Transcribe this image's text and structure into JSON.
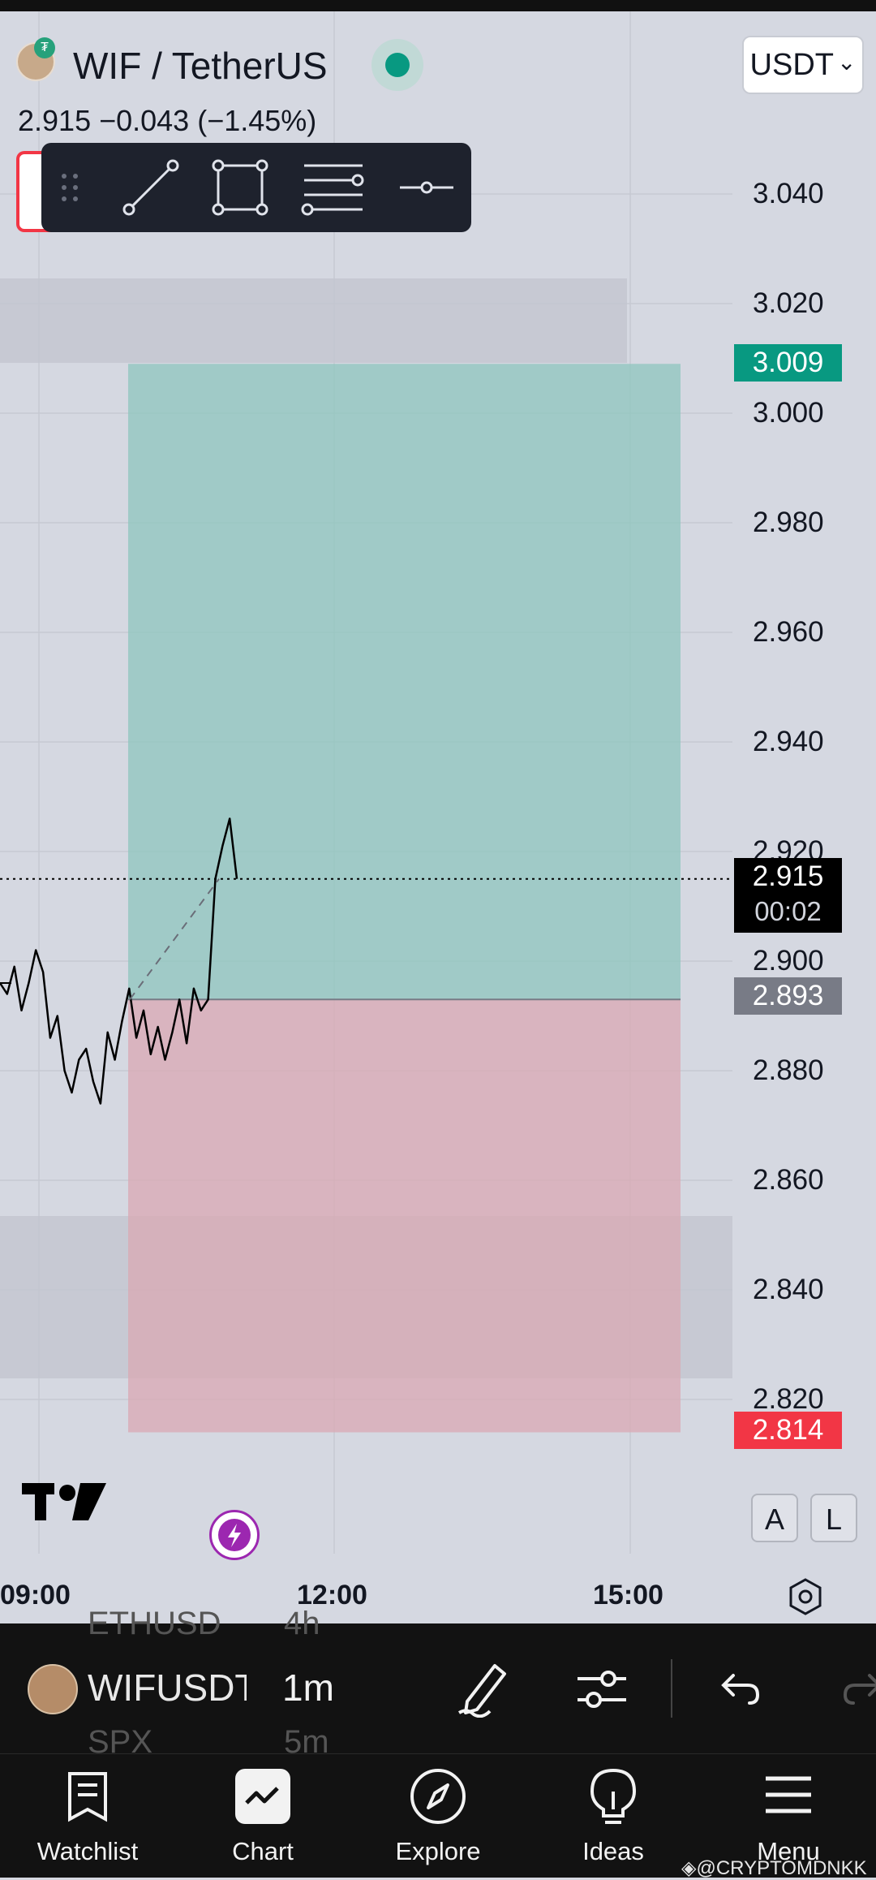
{
  "header": {
    "symbol_title": "WIF / TetherUS",
    "quote": "2.915  −0.043 (−1.45%)",
    "currency": "USDT",
    "currency_chevron": "⌄"
  },
  "drawing_toolbar": {
    "tools": [
      "drag-handle-icon",
      "trend-line-icon",
      "rectangle-icon",
      "fib-retracement-icon",
      "horizontal-line-icon"
    ]
  },
  "price_scale": {
    "ticks": [
      "3.040",
      "3.020",
      "3.000",
      "2.980",
      "2.960",
      "2.940",
      "2.920",
      "2.900",
      "2.880",
      "2.860",
      "2.840",
      "2.820"
    ],
    "target_tag": "3.009",
    "current_price": "2.915",
    "countdown": "00:02",
    "entry_tag": "2.893",
    "stop_tag": "2.814"
  },
  "time_axis": {
    "labels": [
      "09:00",
      "12:00",
      "15:00"
    ]
  },
  "chart_data": {
    "type": "line",
    "title": "",
    "xlabel": "",
    "ylabel": "",
    "ylim": [
      2.809,
      3.051
    ],
    "x_ticks": [
      "09:00",
      "12:00",
      "15:00"
    ],
    "position_tool": {
      "entry": 2.893,
      "target": 3.009,
      "stop": 2.814
    },
    "current_price": 2.915,
    "series": [
      {
        "values": [
          2.896,
          2.894,
          2.899,
          2.891,
          2.896,
          2.902,
          2.898,
          2.886,
          2.89,
          2.88,
          2.876,
          2.882,
          2.884,
          2.878,
          2.874,
          2.887,
          2.882,
          2.889,
          2.895,
          2.886,
          2.891,
          2.883,
          2.888,
          2.882,
          2.887,
          2.893,
          2.885,
          2.895,
          2.891,
          2.893,
          2.915,
          2.921,
          2.926,
          2.915
        ]
      }
    ]
  },
  "chart_overlay": {
    "mode_buttons": [
      "A",
      "L"
    ]
  },
  "bottom_toolbar": {
    "symbol": "WIFUSDT",
    "interval": "1m",
    "prev_symbol": "ETHUSD",
    "prev_interval": "4h",
    "next_symbol": "SPX",
    "next_interval": "5m"
  },
  "tabs": [
    {
      "label": "Watchlist",
      "icon": "watchlist-icon"
    },
    {
      "label": "Chart",
      "icon": "chart-icon"
    },
    {
      "label": "Explore",
      "icon": "compass-icon"
    },
    {
      "label": "Ideas",
      "icon": "lightbulb-icon"
    },
    {
      "label": "Menu",
      "icon": "menu-icon"
    }
  ],
  "watermark": "@CRYPTOMDNKK",
  "colors": {
    "background": "#d5d8e1",
    "profit_zone": "#8ec6bd",
    "loss_zone": "#d9a8b3",
    "target_tag": "#089981",
    "stop_tag": "#f23645",
    "entry_tag": "#787b86",
    "price_tag": "#000000",
    "toolbar": "#1e222d"
  }
}
